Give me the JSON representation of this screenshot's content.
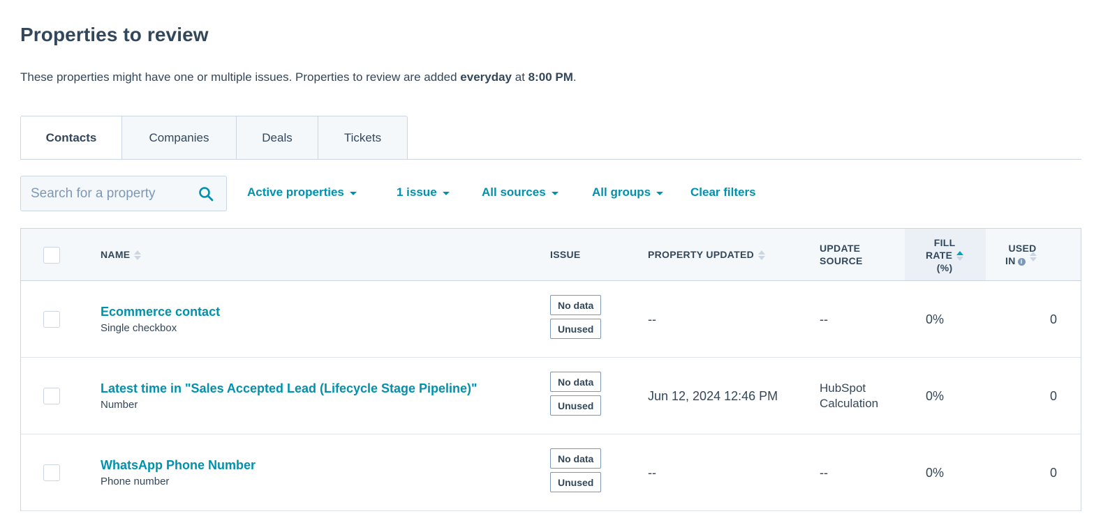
{
  "page": {
    "title": "Properties to review",
    "subtitle_pre": "These properties might have one or multiple issues. Properties to review are added ",
    "subtitle_bold1": "everyday",
    "subtitle_mid": " at ",
    "subtitle_bold2": "8:00 PM",
    "subtitle_post": "."
  },
  "tabs": [
    {
      "label": "Contacts",
      "active": true
    },
    {
      "label": "Companies",
      "active": false
    },
    {
      "label": "Deals",
      "active": false
    },
    {
      "label": "Tickets",
      "active": false
    }
  ],
  "search": {
    "placeholder": "Search for a property",
    "icon": "search-icon"
  },
  "filters": {
    "status": "Active properties",
    "issue": "1 issue",
    "sources": "All sources",
    "groups": "All groups",
    "clear": "Clear filters"
  },
  "table": {
    "headers": {
      "name": "NAME",
      "issue": "ISSUE",
      "property_updated": "PROPERTY UPDATED",
      "update_source_1": "UPDATE",
      "update_source_2": "SOURCE",
      "fill_rate_1": "FILL",
      "fill_rate_2": "RATE",
      "fill_rate_3": "(%)",
      "used_in_1": "USED",
      "used_in_2": "IN"
    },
    "rows": [
      {
        "name": "Ecommerce contact",
        "type": "Single checkbox",
        "tags": [
          "No data",
          "Unused"
        ],
        "updated": "--",
        "source": "--",
        "fill_rate": "0%",
        "used_in": "0"
      },
      {
        "name": "Latest time in \"Sales Accepted Lead (Lifecycle Stage Pipeline)\"",
        "type": "Number",
        "tags": [
          "No data",
          "Unused"
        ],
        "updated": "Jun 12, 2024 12:46 PM",
        "source": "HubSpot Calculation",
        "source_line1": "HubSpot",
        "source_line2": "Calculation",
        "fill_rate": "0%",
        "used_in": "0"
      },
      {
        "name": "WhatsApp Phone Number",
        "type": "Phone number",
        "tags": [
          "No data",
          "Unused"
        ],
        "updated": "--",
        "source": "--",
        "fill_rate": "0%",
        "used_in": "0"
      }
    ]
  },
  "colors": {
    "accent": "#0091ae",
    "text": "#33475b",
    "border": "#cbd6e2",
    "header_bg": "#f5f8fa"
  }
}
